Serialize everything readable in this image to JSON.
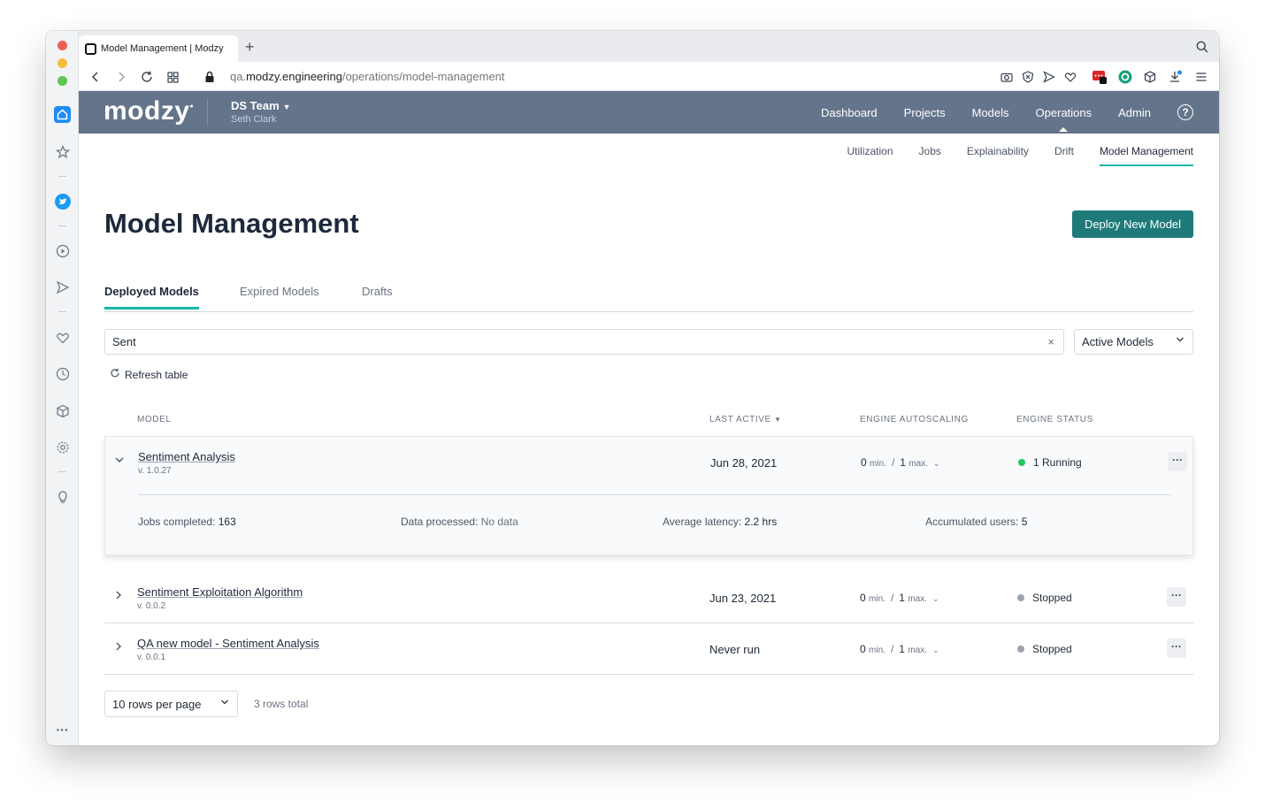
{
  "browser": {
    "tab_title": "Model Management | Modzy",
    "url_prefix": "qa.",
    "url_domain": "modzy.engineering",
    "url_path": "/operations/model-management",
    "traffic_colors": [
      "#ee5f58",
      "#f6be3b",
      "#5fc453"
    ]
  },
  "header": {
    "logo": "modzy",
    "team": "DS Team",
    "user": "Seth Clark",
    "nav": [
      "Dashboard",
      "Projects",
      "Models",
      "Operations",
      "Admin"
    ],
    "help": "?"
  },
  "subnav": [
    "Utilization",
    "Jobs",
    "Explainability",
    "Drift",
    "Model Management"
  ],
  "page": {
    "title": "Model Management",
    "deploy_label": "Deploy New Model",
    "tabs": [
      "Deployed Models",
      "Expired Models",
      "Drafts"
    ],
    "search_value": "Sent",
    "clear": "×",
    "filter": "Active Models",
    "refresh": "Refresh table"
  },
  "table": {
    "headers": {
      "model": "MODEL",
      "last_active": "LAST ACTIVE",
      "autoscaling": "ENGINE AUTOSCALING",
      "status": "ENGINE STATUS"
    },
    "min_label": "min.",
    "max_label": "max.",
    "rows": [
      {
        "name": "Sentiment Analysis",
        "version": "v. 1.0.27",
        "last_active": "Jun 28, 2021",
        "min": "0",
        "max": "1",
        "status": "1 Running",
        "status_color": "#22c55e",
        "details": {
          "jobs_label": "Jobs completed:",
          "jobs_value": "163",
          "data_label": "Data processed:",
          "data_value": "No data",
          "latency_label": "Average latency:",
          "latency_value": "2.2 hrs",
          "users_label": "Accumulated users:",
          "users_value": "5"
        }
      },
      {
        "name": "Sentiment Exploitation Algorithm",
        "version": "v. 0.0.2",
        "last_active": "Jun 23, 2021",
        "min": "0",
        "max": "1",
        "status": "Stopped",
        "status_color": "#9ca3af"
      },
      {
        "name": "QA new model - Sentiment Analysis",
        "version": "v. 0.0.1",
        "last_active": "Never run",
        "min": "0",
        "max": "1",
        "status": "Stopped",
        "status_color": "#9ca3af"
      }
    ]
  },
  "footer": {
    "rows_per_page": "10 rows per page",
    "total": "3 rows total"
  }
}
